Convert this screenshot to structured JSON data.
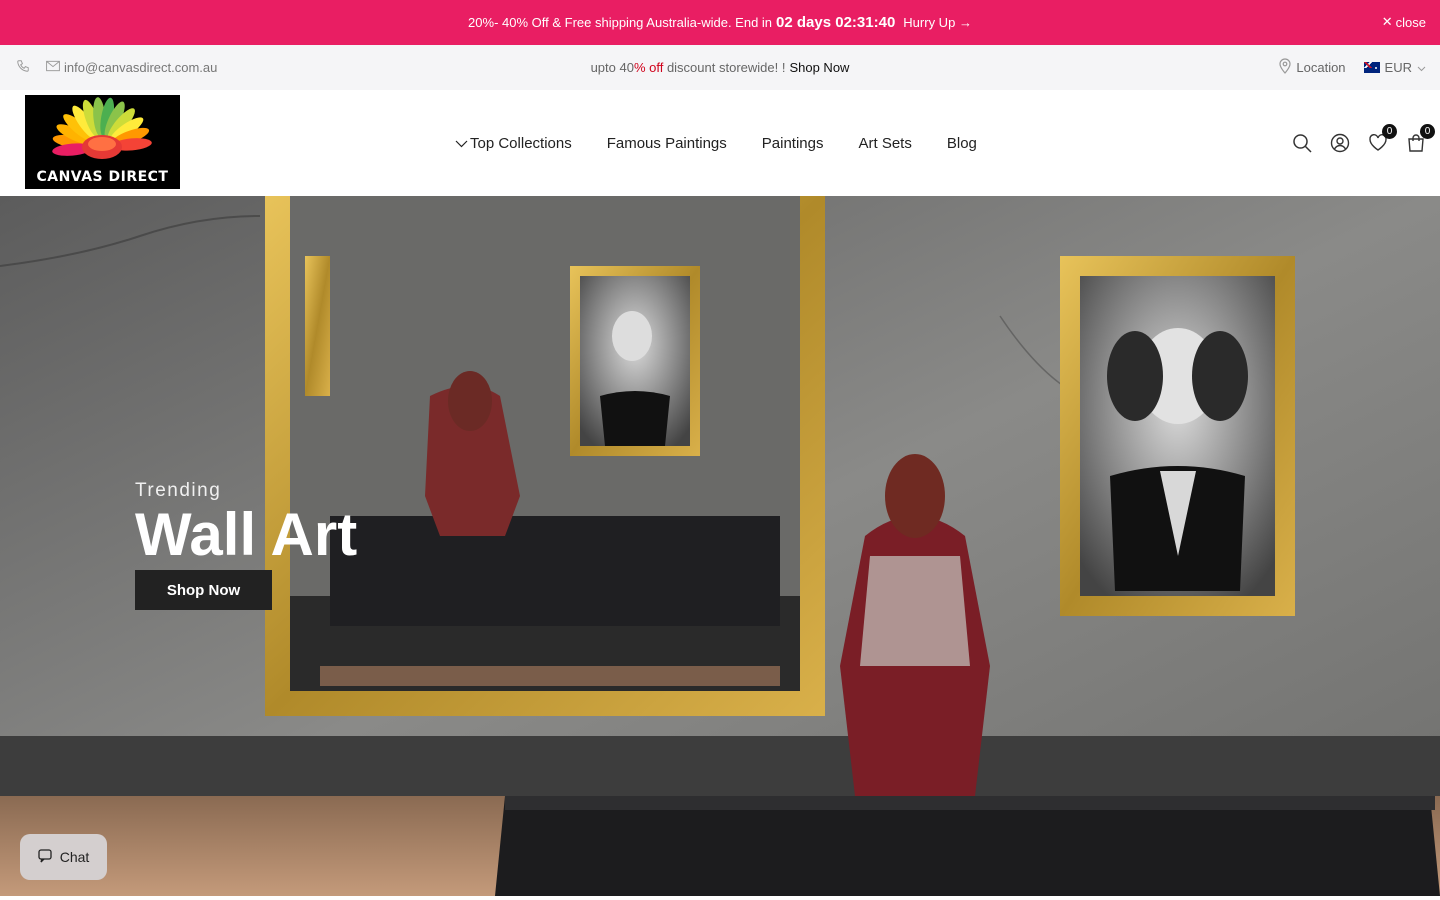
{
  "announcement": {
    "text": "20%- 40% Off & Free shipping Australia-wide. End in",
    "timer": "02 days 02:31:40",
    "hurry": "Hurry Up",
    "close_label": "close"
  },
  "topbar": {
    "email": "info@canvasdirect.com.au",
    "promo_prefix": "upto 40",
    "promo_off": "% off",
    "promo_suffix": " discount storewide! !",
    "promo_link": "Shop Now",
    "location": "Location",
    "currency": "EUR"
  },
  "header": {
    "logo_text": "CANVAS DIRECT",
    "nav": [
      "Top Collections",
      "Famous Paintings",
      "Paintings",
      "Art Sets",
      "Blog"
    ],
    "wishlist_count": "0",
    "cart_count": "0"
  },
  "hero": {
    "subtitle": "Trending",
    "title": "Wall Art",
    "button": "Shop Now"
  },
  "chat": {
    "label": "Chat"
  },
  "colors": {
    "announce_bg": "#e91e63",
    "topbar_bg": "#f5f5f7",
    "accent_red": "#d0021b",
    "frame_gold": "#c9a23a"
  },
  "icons": [
    "phone-icon",
    "mail-icon",
    "location-pin-icon",
    "chevron-down-icon",
    "search-icon",
    "account-icon",
    "heart-icon",
    "cart-icon",
    "chat-icon",
    "close-icon",
    "arrow-right-icon"
  ]
}
